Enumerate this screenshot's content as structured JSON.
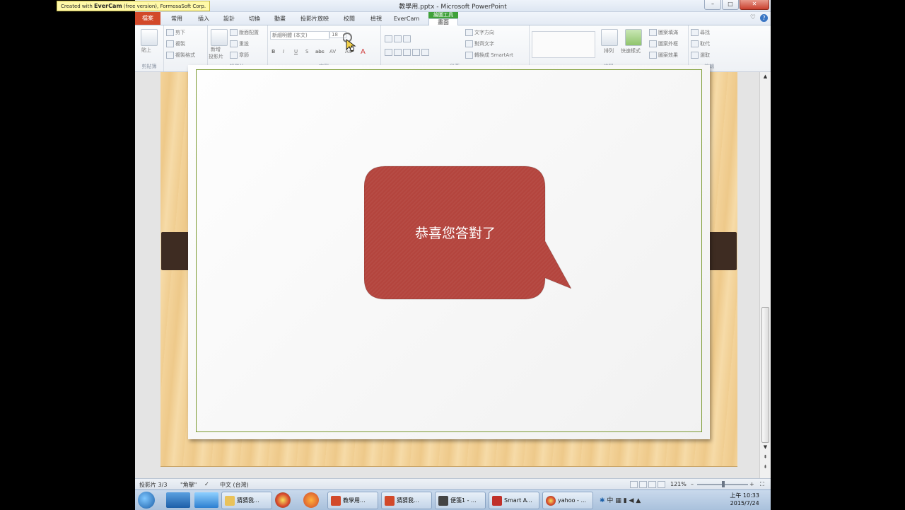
{
  "overlay": {
    "evercam_prefix": "Created with",
    "evercam_brand": "EverCam",
    "evercam_suffix": "(free version), FormosaSoft Corp."
  },
  "window": {
    "title": "教學用.pptx - Microsoft PowerPoint",
    "min": "–",
    "max": "□",
    "close": "✕"
  },
  "tabs": {
    "file": "檔案",
    "home": "常用",
    "insert": "插入",
    "design": "設計",
    "transitions": "切換",
    "animations": "動畫",
    "slideshow": "投影片放映",
    "review": "校閱",
    "view": "檢視",
    "evercam": "EverCam",
    "tool_context": "繪圖工具",
    "format": "畫面"
  },
  "ribbon": {
    "clipboard": {
      "label": "剪貼簿",
      "paste": "貼上",
      "cut": "剪下",
      "copy": "複製",
      "format_painter": "複製格式"
    },
    "slides": {
      "label": "投影片",
      "new_slide": "新增",
      "new_slide2": "投影片",
      "layout": "版面配置",
      "reset": "重設",
      "section": "章節"
    },
    "font": {
      "label": "字型",
      "font_name": "新細明體 (本文)",
      "font_size": "18",
      "b": "B",
      "i": "I",
      "u": "U",
      "s": "S",
      "abc": "abc",
      "av": "AV",
      "aa": "Aa",
      "a": "A"
    },
    "paragraph": {
      "label": "段落",
      "text_direction": "文字方向",
      "align_text": "對齊文字",
      "smartart": "轉換成 SmartArt"
    },
    "drawing": {
      "label": "繪圖",
      "arrange": "排列",
      "quick_styles": "快速樣式",
      "fill": "圖案填滿",
      "outline": "圖案外框",
      "effects": "圖案效果"
    },
    "editing": {
      "label": "編輯",
      "find": "尋找",
      "replace": "取代",
      "select": "選取"
    }
  },
  "slide": {
    "bubble_text": "恭喜您答對了",
    "bubble_color": "#b4453e"
  },
  "status": {
    "slide_info": "投影片 3/3",
    "theme": "\"角擊\"",
    "language": "中文 (台灣)",
    "zoom": "121%",
    "zoom_minus": "–",
    "zoom_plus": "+",
    "zoom_level_fraction": 0.52
  },
  "taskbar": {
    "buttons": [
      "猜猜我...",
      "教學用...",
      "猜猜我...",
      "便箋1 - ...",
      "Smart A...",
      "yahoo - ..."
    ],
    "ime": "中",
    "time": "上午 10:33",
    "date": "2015/7/24"
  }
}
